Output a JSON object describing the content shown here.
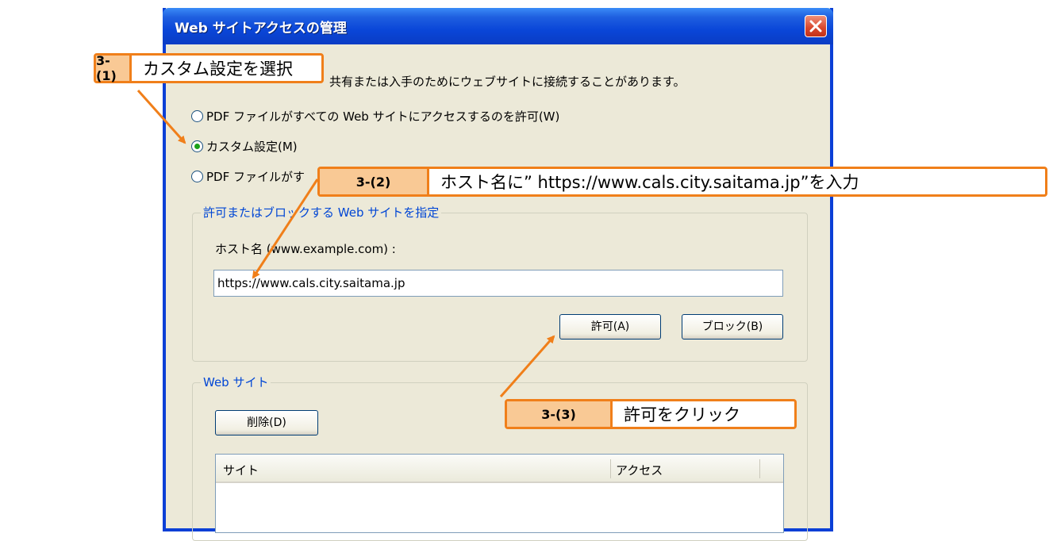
{
  "window": {
    "title": "Web サイトアクセスの管理",
    "description": "共有または入手のためにウェブサイトに接続することがあります。"
  },
  "radios": [
    {
      "label": "PDF ファイルがすべての Web サイトにアクセスするのを許可(W)",
      "checked": false
    },
    {
      "label": "カスタム設定(M)",
      "checked": true
    },
    {
      "label": "PDF ファイルがす",
      "checked": false
    }
  ],
  "site_group": {
    "legend": "許可またはブロックする Web サイトを指定",
    "host_label": "ホスト名 (www.example.com) :",
    "host_value": "https://www.cals.city.saitama.jp",
    "allow_button": "許可(A)",
    "block_button": "ブロック(B)"
  },
  "web_group": {
    "legend": "Web サイト",
    "delete_button": "削除(D)",
    "columns": [
      "サイト",
      "アクセス"
    ]
  },
  "callouts": [
    {
      "tag": "3-(1)",
      "text": "カスタム設定を選択"
    },
    {
      "tag": "3-(2)",
      "text": "ホスト名に” https://www.cals.city.saitama.jp”を入力"
    },
    {
      "tag": "3-(3)",
      "text": "許可をクリック"
    }
  ],
  "colors": {
    "accent": "#f07f1a",
    "tag_fill": "#f9c995",
    "titlebar": "#0a46d8",
    "dialog_bg": "#ece9d8"
  }
}
